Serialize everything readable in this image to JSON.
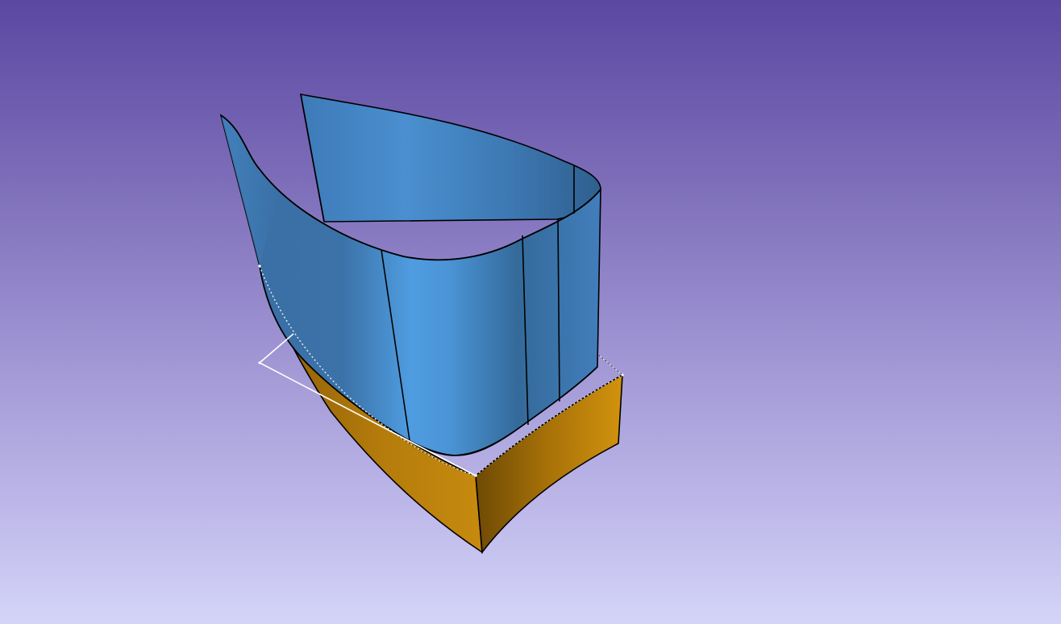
{
  "viewer": {
    "background_top": "#5a48a2",
    "background_bottom": "#d4d4f8"
  },
  "objects": [
    {
      "id": "blue-wall",
      "kind": "curved surface shell",
      "color": "#4f98dc",
      "shade_color": "#3a6ea2",
      "selected": false
    },
    {
      "id": "orange-block",
      "kind": "curved solid",
      "color": "#d2900e",
      "shade_color": "#7a5206",
      "selected": false
    },
    {
      "id": "selected-sketch",
      "kind": "sketch outline",
      "color": "#ffffff",
      "selected": true
    }
  ]
}
